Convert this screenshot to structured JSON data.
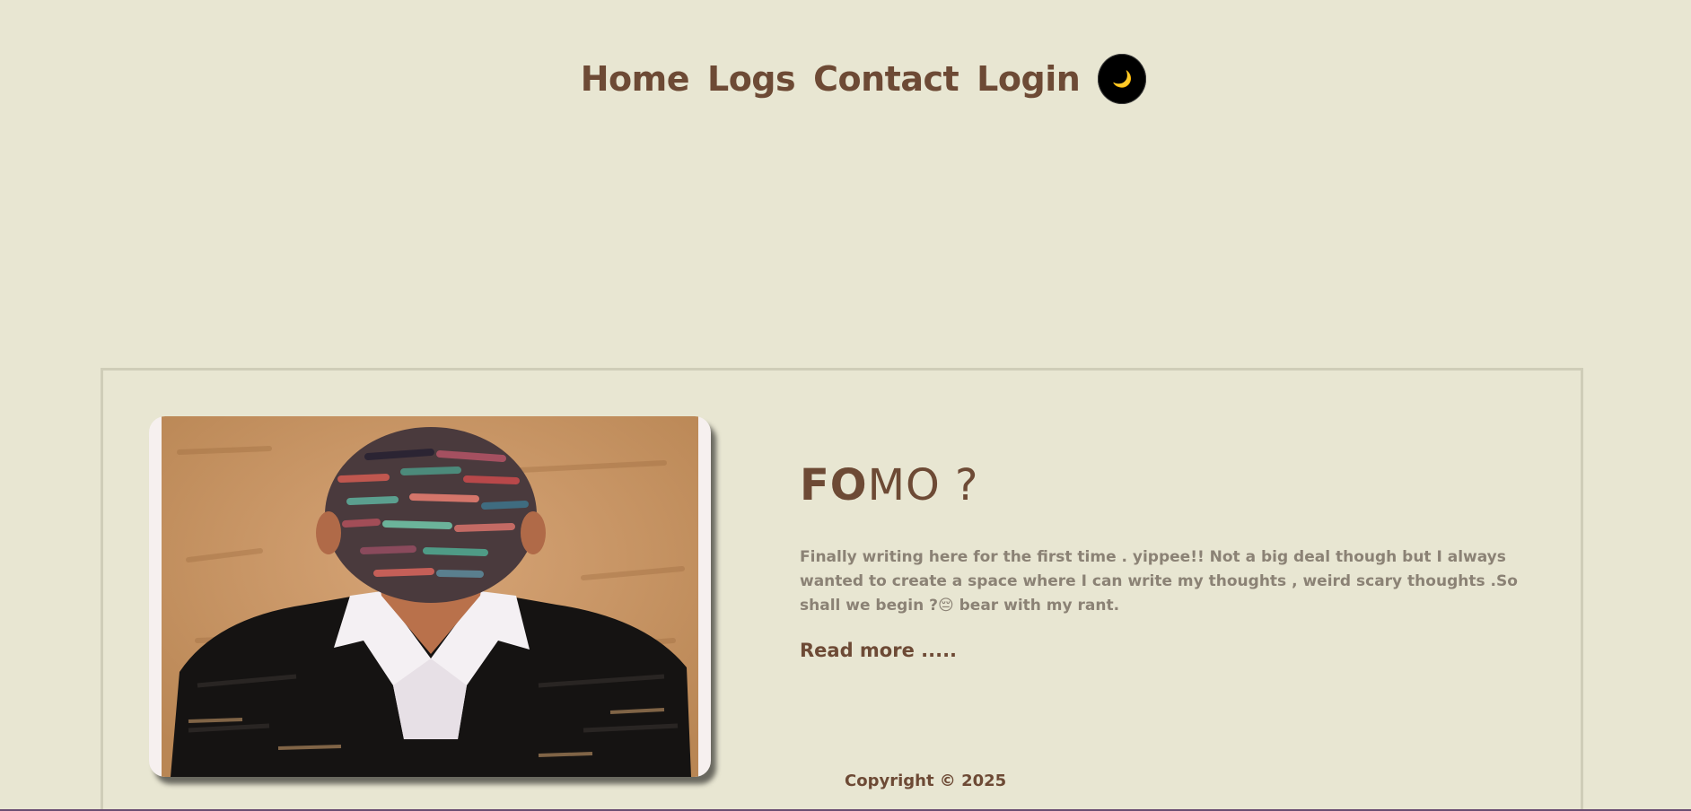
{
  "nav": {
    "home": "Home",
    "logs": "Logs",
    "contact": "Contact",
    "login": "Login",
    "theme_toggle_icon": "moon-icon",
    "theme_toggle_glyph": "🌙"
  },
  "post": {
    "title_part1": "FO",
    "title_part2": "MO ?",
    "excerpt": "Finally writing here for the first time . yippee!! Not a big deal though but I always wanted to create a space where I can write my thoughts , weird scary thoughts .So shall we begin ?😔 bear with my rant.",
    "read_more": "Read more .....",
    "image_alt": "painting of a faceless figure in a suit"
  },
  "footer": {
    "copyright": "Copyright © 2025"
  },
  "colors": {
    "background": "#e8e6d2",
    "brand_brown": "#6d4a35",
    "excerpt_gray": "#8b8275",
    "card_border": "#cfcdb8"
  }
}
